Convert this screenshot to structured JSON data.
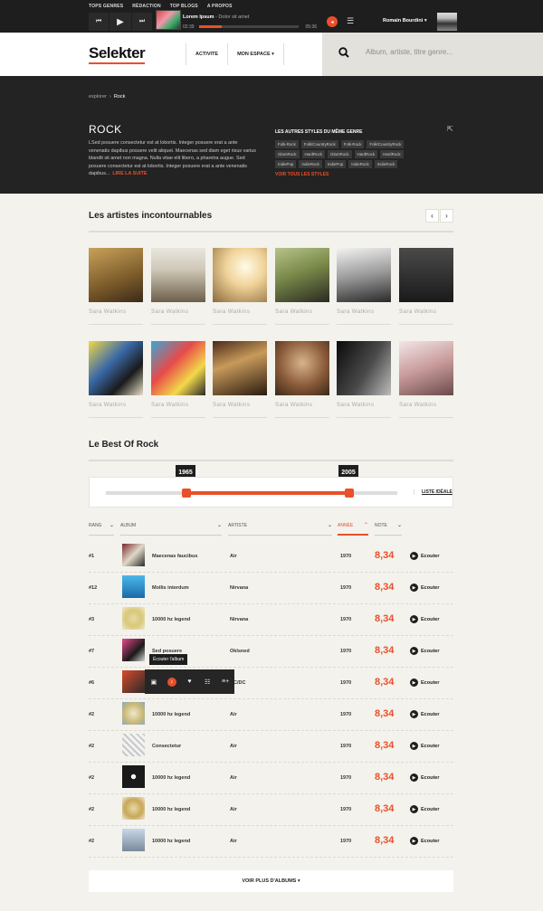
{
  "topnav": {
    "links": [
      "TOPS GENRES",
      "RÉDACTION",
      "TOP BLOGS",
      "A PROPOS"
    ]
  },
  "player": {
    "track_title": "Lorem Ipsum",
    "track_sub": " - Dolor sit amet",
    "elapsed": "02:39",
    "duration": "05:36",
    "progress": 0.23,
    "user": "Romain Bourdini"
  },
  "header": {
    "logo": "Selekter",
    "nav": [
      "ACTIVITE",
      "MON ESPACE"
    ],
    "search_placeholder": "Album, artiste, titre genre..."
  },
  "genre": {
    "breadcrumb": [
      "explorer",
      "Rock"
    ],
    "title": "ROCK",
    "description": "LSed posuere consectetur est at lobortis. Integer posuere erat a ante venenatis dapibus posuere velit aliquet. Maecenas sed diam eget risus varius blandit sit amet non magna. Nulla vitae elit libero, a pharetra augue. Sed posuere consectetur est at lobortis. Integer posuere erat a ante venenatis dapibus...",
    "read_more": "LIRE LA SUITE",
    "other_styles_title": "LES AUTRES STYLES DU MÊME GENRE",
    "tags": [
      "Folk-Rock",
      "Folk/CountryRock",
      "Folk-Rock",
      "Folk/CountryRock",
      "GlamRock",
      "HardRock",
      "GlamRock",
      "HardRock",
      "HardRock",
      "IndiePop",
      "IndieRock",
      "IndiePop",
      "IndieRock",
      "IndieRock"
    ],
    "see_all": "VOIR TOUS LES STYLES"
  },
  "artists": {
    "title": "Les artistes incontournables",
    "prev": "‹",
    "next": "›",
    "items": [
      {
        "name": "Sara Watkins"
      },
      {
        "name": "Sara Watkins"
      },
      {
        "name": "Sara Watkins"
      },
      {
        "name": "Sara Watkins"
      },
      {
        "name": "Sara Watkins"
      },
      {
        "name": "Sara Watkins"
      },
      {
        "name": "Sara Watkins"
      },
      {
        "name": "Sara Watkins"
      },
      {
        "name": "Sara Watkins"
      },
      {
        "name": "Sara Watkins"
      },
      {
        "name": "Sara Watkins"
      },
      {
        "name": "Sara Watkins"
      }
    ]
  },
  "best": {
    "title": "Le Best Of Rock",
    "year_from": "1965",
    "year_to": "2005",
    "list_label": "LISTE IDÉALE",
    "columns": [
      "RANG",
      "ALBUM",
      "ARTISTE",
      "ANNÉE",
      "NOTE"
    ],
    "play_label": "Ecouter",
    "tooltip": "Écouter l'album",
    "rows": [
      {
        "rank": "#1",
        "album": "Maecenas faucibus",
        "artist": "Air",
        "year": "1970",
        "note": "8,34"
      },
      {
        "rank": "#12",
        "album": "Mollis interdum",
        "artist": "Nirvana",
        "year": "1970",
        "note": "8,34"
      },
      {
        "rank": "#3",
        "album": "10000 hz legend",
        "artist": "Nirvana",
        "year": "1970",
        "note": "8,34"
      },
      {
        "rank": "#7",
        "album": "Sed posuere",
        "artist": "Oklsned",
        "year": "1970",
        "note": "8,34"
      },
      {
        "rank": "#6",
        "album": "",
        "artist": "AC/DC",
        "year": "1970",
        "note": "8,34"
      },
      {
        "rank": "#2",
        "album": "10000 hz legend",
        "artist": "Air",
        "year": "1970",
        "note": "8,34"
      },
      {
        "rank": "#2",
        "album": "Consectetur",
        "artist": "Air",
        "year": "1970",
        "note": "8,34"
      },
      {
        "rank": "#2",
        "album": "10000 hz legend",
        "artist": "Air",
        "year": "1970",
        "note": "8,34"
      },
      {
        "rank": "#2",
        "album": "10000 hz legend",
        "artist": "Air",
        "year": "1970",
        "note": "8,34"
      },
      {
        "rank": "#2",
        "album": "10000 hz legend",
        "artist": "Air",
        "year": "1970",
        "note": "8,34"
      }
    ],
    "load_more": "VOIR PLUS D'ALBUMS"
  }
}
